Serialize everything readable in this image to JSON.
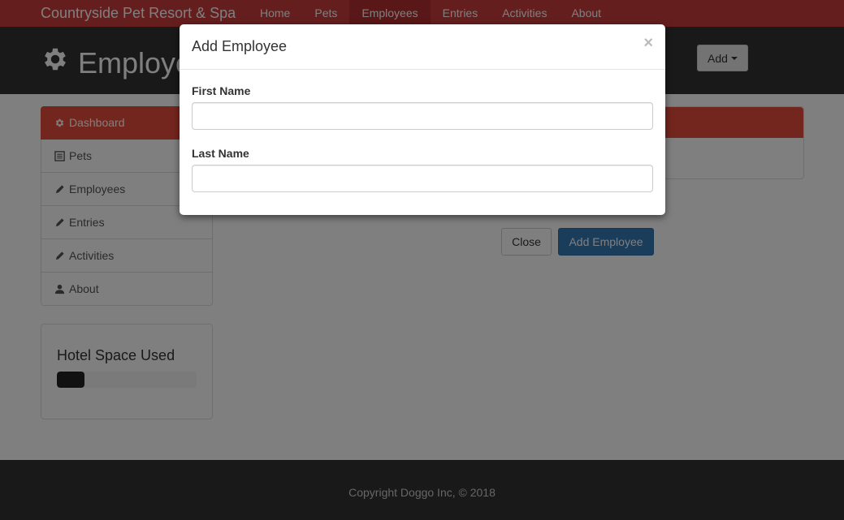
{
  "navbar": {
    "brand": "Countryside Pet Resort & Spa",
    "items": [
      {
        "label": "Home",
        "active": false
      },
      {
        "label": "Pets",
        "active": false
      },
      {
        "label": "Employees",
        "active": true
      },
      {
        "label": "Entries",
        "active": false
      },
      {
        "label": "Activities",
        "active": false
      },
      {
        "label": "About",
        "active": false
      }
    ],
    "color": "#ca3c3c"
  },
  "header": {
    "title": "Employe",
    "title_icon": "gear-icon",
    "add_label": "Add"
  },
  "sidebar": {
    "items": [
      {
        "label": "Dashboard",
        "icon": "gear-icon",
        "active": true
      },
      {
        "label": "Pets",
        "icon": "list-icon",
        "active": false
      },
      {
        "label": "Employees",
        "icon": "pencil-icon",
        "active": false
      },
      {
        "label": "Entries",
        "icon": "pencil-icon",
        "active": false
      },
      {
        "label": "Activities",
        "icon": "pencil-icon",
        "active": false
      },
      {
        "label": "About",
        "icon": "user-icon",
        "active": false
      }
    ]
  },
  "hotel_space": {
    "title": "Hotel Space Used",
    "progress_fraction": 0.2
  },
  "background_buttons": {
    "close_label": "Close",
    "add_employee_label": "Add Employee"
  },
  "footer": {
    "text": "Copyright Doggo Inc, © 2018"
  },
  "modal": {
    "title": "Add Employee",
    "close_symbol": "×",
    "fields": [
      {
        "label": "First Name",
        "value": "",
        "placeholder": ""
      },
      {
        "label": "Last Name",
        "value": "",
        "placeholder": ""
      }
    ]
  },
  "colors": {
    "accent": "#e74c3c",
    "primary": "#337ab7",
    "dark": "#333333"
  }
}
